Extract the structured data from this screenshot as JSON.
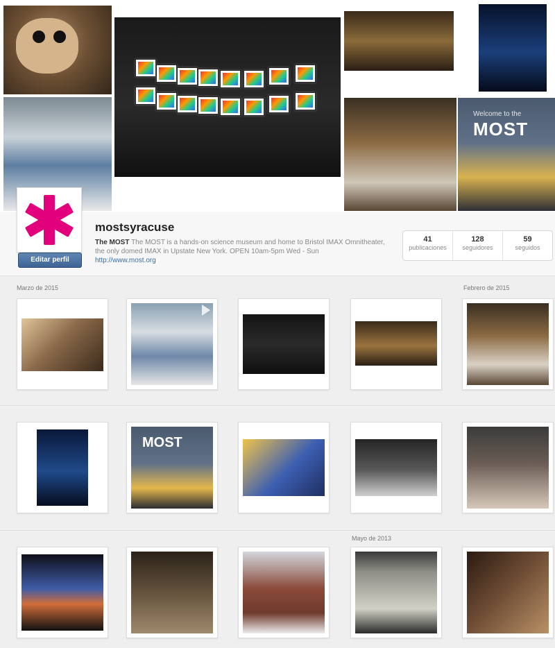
{
  "banner": {
    "most_logo_text": "MOST",
    "welcome_text": "Welcome to the"
  },
  "profile": {
    "username": "mostsyracuse",
    "bio_name": "The MOST",
    "bio_text": "The MOST is a hands-on science museum and home to Bristol IMAX Omnitheater, the only domed IMAX in Upstate New York. OPEN 10am-5pm Wed - Sun",
    "website": "http://www.most.org",
    "edit_button": "Editar perfil",
    "stats": [
      {
        "number": "41",
        "label": "publicaciones"
      },
      {
        "number": "128",
        "label": "seguidores"
      },
      {
        "number": "59",
        "label": "seguidos"
      }
    ]
  },
  "grid": {
    "section_labels": {
      "march_2015": "Marzo de 2015",
      "february_2015": "Febrero de 2015",
      "may_2013": "Mayo de 2013"
    },
    "tiles": [
      {
        "name": "Lemur post",
        "color": "#6e5134"
      },
      {
        "name": "Science fair hall video",
        "color": "#6f86a6"
      },
      {
        "name": "Gallery wall",
        "color": "#1b1b1b"
      },
      {
        "name": "Exhibit room",
        "color": "#7a5a33"
      },
      {
        "name": "Museum shop",
        "color": "#7b5f3f"
      },
      {
        "name": "Robot exhibit",
        "color": "#0b1d44"
      },
      {
        "name": "MOST lobby",
        "color": "#52627a"
      },
      {
        "name": "Girl at microscope",
        "color": "#3d5fb2"
      },
      {
        "name": "Fossil table",
        "color": "#3a3a3a"
      },
      {
        "name": "Visitors in hall",
        "color": "#5a4e47"
      },
      {
        "name": "Cockpit exhibit",
        "color": "#2a2a36"
      },
      {
        "name": "Framed photos",
        "color": "#4a3b2c"
      },
      {
        "name": "Armory building",
        "color": "#7a4638"
      },
      {
        "name": "Old photo",
        "color": "#8f8f88"
      },
      {
        "name": "Stairs",
        "color": "#5b3f2a"
      }
    ]
  }
}
